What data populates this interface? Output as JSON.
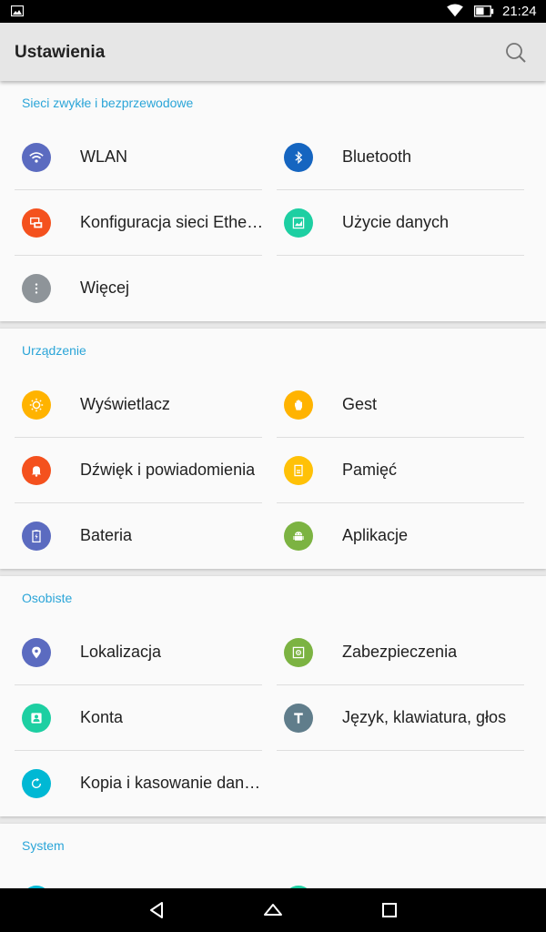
{
  "status_bar": {
    "time": "21:24",
    "icons": [
      "image-notification-icon",
      "wifi-icon",
      "battery-icon"
    ]
  },
  "app_bar": {
    "title": "Ustawienia",
    "search_icon": "search-icon"
  },
  "sections": [
    {
      "title": "Sieci zwykłe i bezprzewodowe",
      "items": [
        {
          "label": "WLAN",
          "icon": "wifi-icon",
          "color": "#5b6bc0"
        },
        {
          "label": "Bluetooth",
          "icon": "bluetooth-icon",
          "color": "#1565c0"
        },
        {
          "label": "Konfiguracja sieci Ethernet",
          "icon": "ethernet-icon",
          "color": "#f4511e"
        },
        {
          "label": "Użycie danych",
          "icon": "data-usage-icon",
          "color": "#1dcfa2"
        },
        {
          "label": "Więcej",
          "icon": "more-icon",
          "color": "#8e9499"
        }
      ]
    },
    {
      "title": "Urządzenie",
      "items": [
        {
          "label": "Wyświetlacz",
          "icon": "brightness-icon",
          "color": "#ffb300"
        },
        {
          "label": "Gest",
          "icon": "gesture-hand-icon",
          "color": "#ffb300"
        },
        {
          "label": "Dźwięk i powiadomienia",
          "icon": "notification-bell-icon",
          "color": "#f4511e"
        },
        {
          "label": "Pamięć",
          "icon": "storage-icon",
          "color": "#ffc107"
        },
        {
          "label": "Bateria",
          "icon": "battery-icon",
          "color": "#5b6bc0"
        },
        {
          "label": "Aplikacje",
          "icon": "android-icon",
          "color": "#7cb342"
        }
      ]
    },
    {
      "title": "Osobiste",
      "items": [
        {
          "label": "Lokalizacja",
          "icon": "location-pin-icon",
          "color": "#5b6bc0"
        },
        {
          "label": "Zabezpieczenia",
          "icon": "security-lock-icon",
          "color": "#7cb342"
        },
        {
          "label": "Konta",
          "icon": "account-icon",
          "color": "#1dcfa2"
        },
        {
          "label": "Język, klawiatura, głos",
          "icon": "language-icon",
          "color": "#607d8b"
        },
        {
          "label": "Kopia i kasowanie danych",
          "icon": "backup-restore-icon",
          "color": "#00b8d4"
        }
      ]
    },
    {
      "title": "System",
      "items": [
        {
          "label": "",
          "icon": "partial-icon",
          "color": "#00b8d4"
        },
        {
          "label": "",
          "icon": "partial-icon",
          "color": "#1dcfa2"
        }
      ]
    }
  ],
  "nav_bar": {
    "buttons": [
      "back-icon",
      "home-icon",
      "recents-icon"
    ]
  }
}
